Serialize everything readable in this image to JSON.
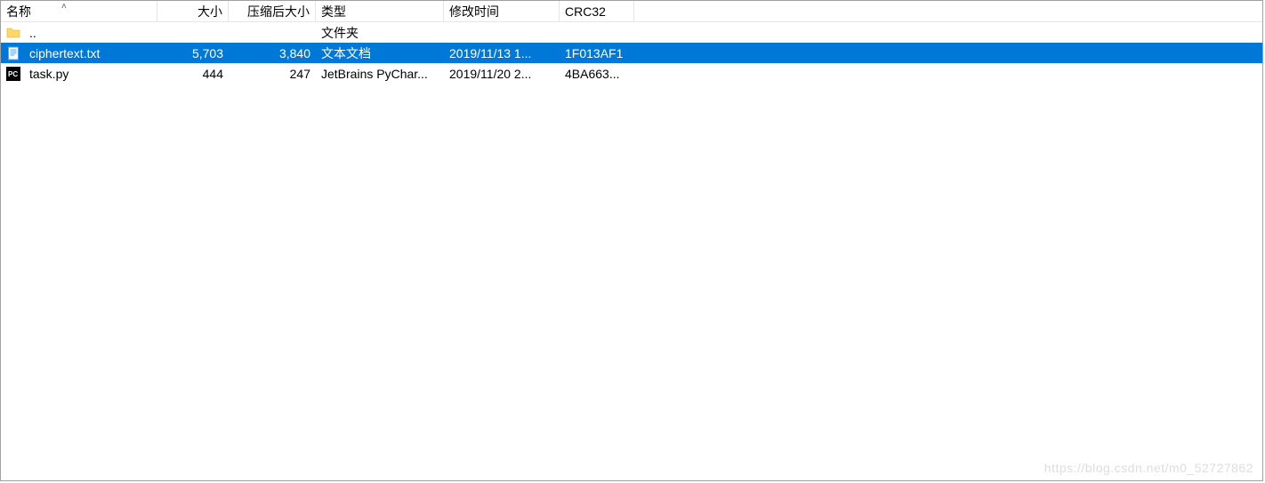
{
  "columns": {
    "name": "名称",
    "size": "大小",
    "csize": "压缩后大小",
    "type": "类型",
    "mtime": "修改时间",
    "crc": "CRC32"
  },
  "sort_indicator": "˄",
  "rows": [
    {
      "icon": "folder",
      "name": "..",
      "size": "",
      "csize": "",
      "type": "文件夹",
      "mtime": "",
      "crc": "",
      "selected": false
    },
    {
      "icon": "txt",
      "name": "ciphertext.txt",
      "size": "5,703",
      "csize": "3,840",
      "type": "文本文档",
      "mtime": "2019/11/13 1...",
      "crc": "1F013AF1",
      "selected": true
    },
    {
      "icon": "pycharm",
      "name": "task.py",
      "size": "444",
      "csize": "247",
      "type": "JetBrains PyChar...",
      "mtime": "2019/11/20 2...",
      "crc": "4BA663...",
      "selected": false
    }
  ],
  "watermark": "https://blog.csdn.net/m0_52727862"
}
